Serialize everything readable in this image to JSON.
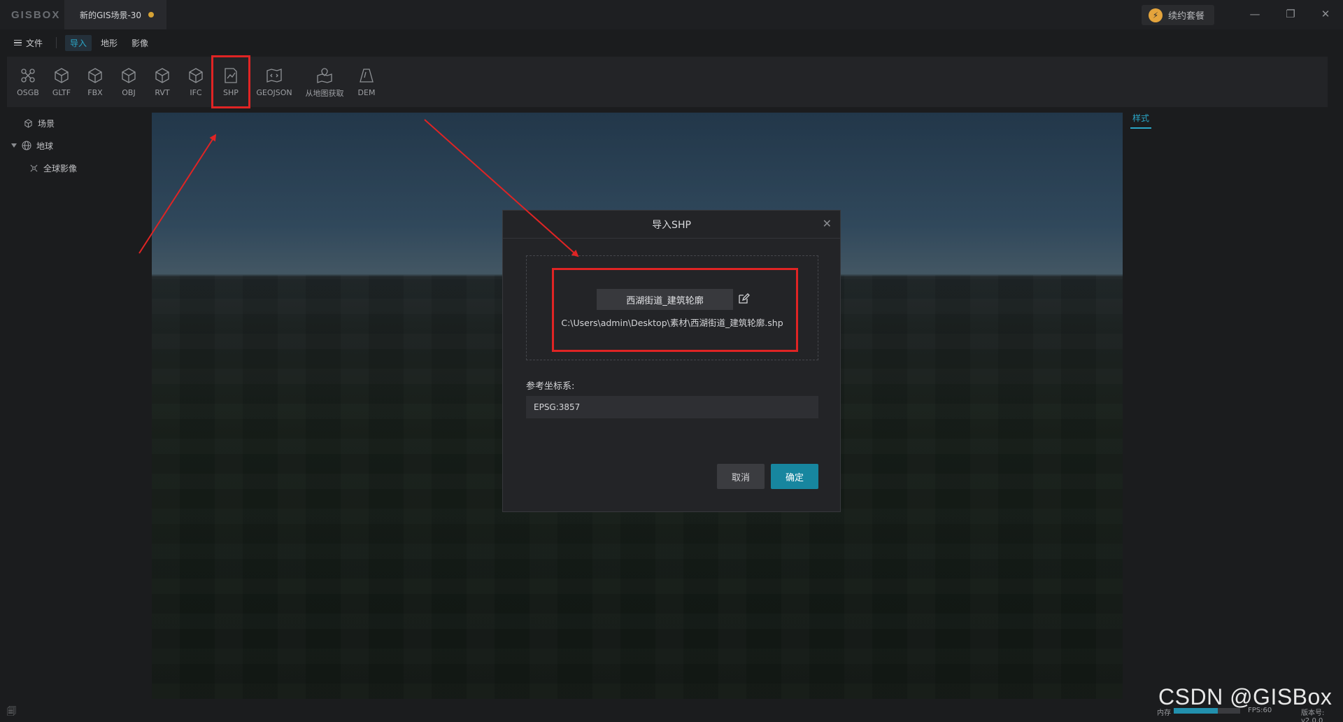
{
  "app": {
    "logo": "GISBOX",
    "doc_tab": "新的GIS场景-30",
    "renew_label": "续约套餐"
  },
  "window_controls": {
    "minimize": "—",
    "restore": "❐",
    "close": "✕"
  },
  "menu": {
    "file_label": "文件",
    "tabs": [
      "导入",
      "地形",
      "影像"
    ],
    "active_tab": 0
  },
  "toolbar": {
    "items": [
      {
        "label": "OSGB",
        "icon": "osgb-icon"
      },
      {
        "label": "GLTF",
        "icon": "cube-icon"
      },
      {
        "label": "FBX",
        "icon": "cube-icon"
      },
      {
        "label": "OBJ",
        "icon": "cube-icon"
      },
      {
        "label": "RVT",
        "icon": "cube-icon"
      },
      {
        "label": "IFC",
        "icon": "cube-icon"
      },
      {
        "label": "SHP",
        "icon": "map-line-icon"
      },
      {
        "label": "GEOJSON",
        "icon": "map-code-icon"
      },
      {
        "label": "从地图获取",
        "icon": "map-pin-icon"
      },
      {
        "label": "DEM",
        "icon": "terrain-icon"
      }
    ]
  },
  "tree": {
    "scene": "场景",
    "earth": "地球",
    "global_imagery": "全球影像"
  },
  "right_panel": {
    "tab": "样式"
  },
  "dialog": {
    "title": "导入SHP",
    "file_name": "西湖街道_建筑轮廓",
    "file_path": "C:\\Users\\admin\\Desktop\\素材\\西湖街道_建筑轮廓.shp",
    "crs_label": "参考坐标系:",
    "crs_value": "EPSG:3857",
    "cancel_label": "取消",
    "ok_label": "确定"
  },
  "status": {
    "memory_label": "内存",
    "memory_fraction": 0.66,
    "fps": "FPS:60",
    "version": "版本号: v2.0.0"
  },
  "watermark": "CSDN @GISBox",
  "colors": {
    "accent": "#2aa6c7",
    "primary_button": "#17869f",
    "annotation": "#e02424",
    "unsaved_dot": "#d6a235"
  }
}
